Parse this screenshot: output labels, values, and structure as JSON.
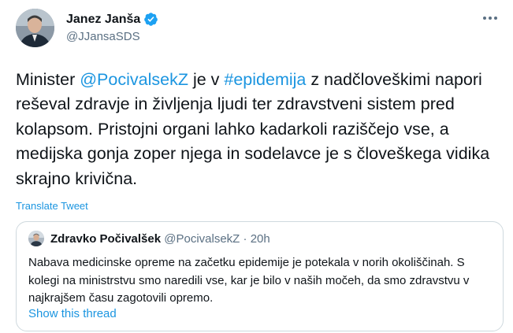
{
  "author": {
    "name": "Janez Janša",
    "handle": "@JJansaSDS",
    "verified": true
  },
  "tweet": {
    "segments": [
      {
        "type": "text",
        "value": "Minister "
      },
      {
        "type": "mention",
        "value": "@PocivalsekZ"
      },
      {
        "type": "text",
        "value": " je v "
      },
      {
        "type": "hashtag",
        "value": "#epidemija"
      },
      {
        "type": "text",
        "value": " z nadčloveškimi napori reševal zdravje in življenja ljudi ter zdravstveni sistem pred kolapsom. Pristojni organi lahko kadarkoli raziščejo vse, a medijska gonja zoper njega in sodelavce je s človeškega vidika skrajno krivična."
      }
    ],
    "translate_label": "Translate Tweet"
  },
  "quote": {
    "name": "Zdravko Počivalšek",
    "handle": "@PocivalsekZ",
    "separator": " · ",
    "time": "20h",
    "text": "Nabava medicinske opreme na začetku epidemije je potekala v norih okoliščinah. S kolegi na ministrstvu smo naredili vse, kar je bilo v naših močeh, da smo zdravstvu v najkrajšem času zagotovili opremo.",
    "show_thread_label": "Show this thread"
  },
  "icons": {
    "verified": "verified-badge-icon",
    "more": "more-options-icon"
  },
  "colors": {
    "link": "#1b95e0",
    "text": "#0f1419",
    "secondary": "#5b7083",
    "border": "#cfd9de",
    "verified": "#1da1f2"
  }
}
